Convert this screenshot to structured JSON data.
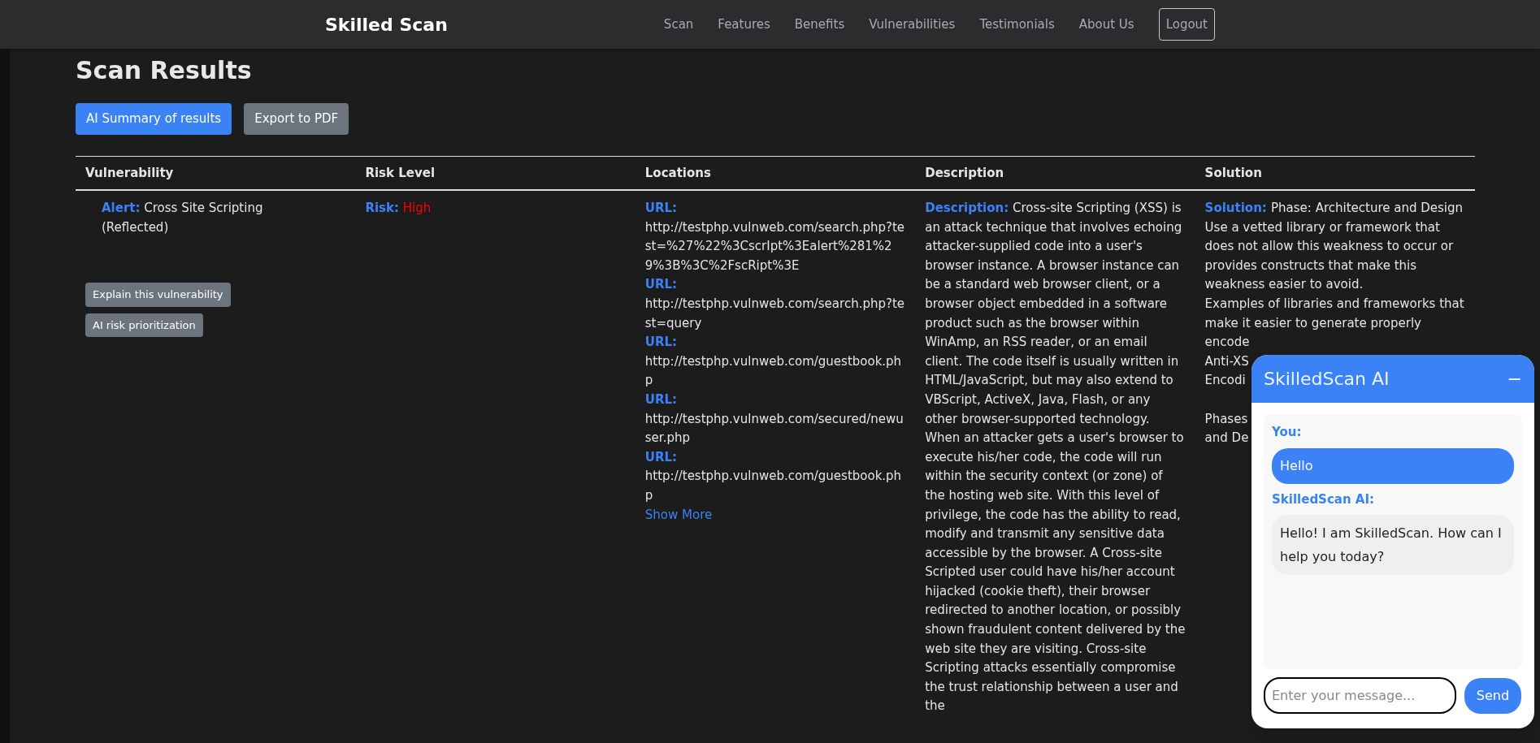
{
  "navbar": {
    "brand": "Skilled Scan",
    "links": [
      "Scan",
      "Features",
      "Benefits",
      "Vulnerabilities",
      "Testimonials",
      "About Us"
    ],
    "logout": "Logout"
  },
  "page_title": "Scan Results",
  "actions": [
    {
      "label": "AI Summary of results",
      "kind": "primary"
    },
    {
      "label": "Export to PDF",
      "kind": "secondary"
    }
  ],
  "table": {
    "columns": [
      "Vulnerability",
      "Risk Level",
      "Locations",
      "Description",
      "Solution"
    ],
    "rows": [
      {
        "alert_label": "Alert:",
        "alert": "Cross Site Scripting (Reflected)",
        "buttons": [
          "Explain this vulnerability",
          "AI risk prioritization"
        ],
        "risk_label": "Risk:",
        "risk": "High",
        "locations": [
          {
            "label": "URL:",
            "url": "http://testphp.vulnweb.com/search.php?test=%27%22%3CscrIpt%3Ealert%281%29%3B%3C%2FscRipt%3E"
          },
          {
            "label": "URL:",
            "url": "http://testphp.vulnweb.com/search.php?test=query"
          },
          {
            "label": "URL:",
            "url": "http://testphp.vulnweb.com/guestbook.php"
          },
          {
            "label": "URL:",
            "url": "http://testphp.vulnweb.com/secured/newuser.php"
          },
          {
            "label": "URL:",
            "url": "http://testphp.vulnweb.com/guestbook.php"
          }
        ],
        "show_more": "Show More",
        "description_label": "Description:",
        "description": "Cross-site Scripting (XSS) is an attack technique that involves echoing attacker-supplied code into a user's browser instance. A browser instance can be a standard web browser client, or a browser object embedded in a software product such as the browser within WinAmp, an RSS reader, or an email client. The code itself is usually written in HTML/JavaScript, but may also extend to VBScript, ActiveX, Java, Flash, or any other browser-supported technology. When an attacker gets a user's browser to execute his/her code, the code will run within the security context (or zone) of the hosting web site. With this level of privilege, the code has the ability to read, modify and transmit any sensitive data accessible by the browser. A Cross-site Scripted user could have his/her account hijacked (cookie theft), their browser redirected to another location, or possibly shown fraudulent content delivered by the web site they are visiting. Cross-site Scripting attacks essentially compromise the trust relationship between a user and the",
        "solution_label": "Solution:",
        "solution_lines": [
          "Phase: Architecture and Design",
          "Use a vetted library or framework that does not allow this weakness to occur or provides constructs that make this weakness easier to avoid.",
          "Examples of libraries and frameworks that make it easier to generate properly"
        ],
        "solution_covered": [
          [
            "encode",
            "Anti-XS",
            "Encodi"
          ],
          [
            "Phases",
            "and De"
          ]
        ]
      }
    ]
  },
  "chat": {
    "title": "SkilledScan AI",
    "minimize": "−",
    "messages": [
      {
        "kind": "user",
        "sender": "You:",
        "text": "Hello"
      },
      {
        "kind": "bot",
        "sender": "SkilledScan AI:",
        "text": "Hello! I am SkilledScan. How can I help you today?"
      }
    ],
    "placeholder": "Enter your message...",
    "send": "Send"
  }
}
